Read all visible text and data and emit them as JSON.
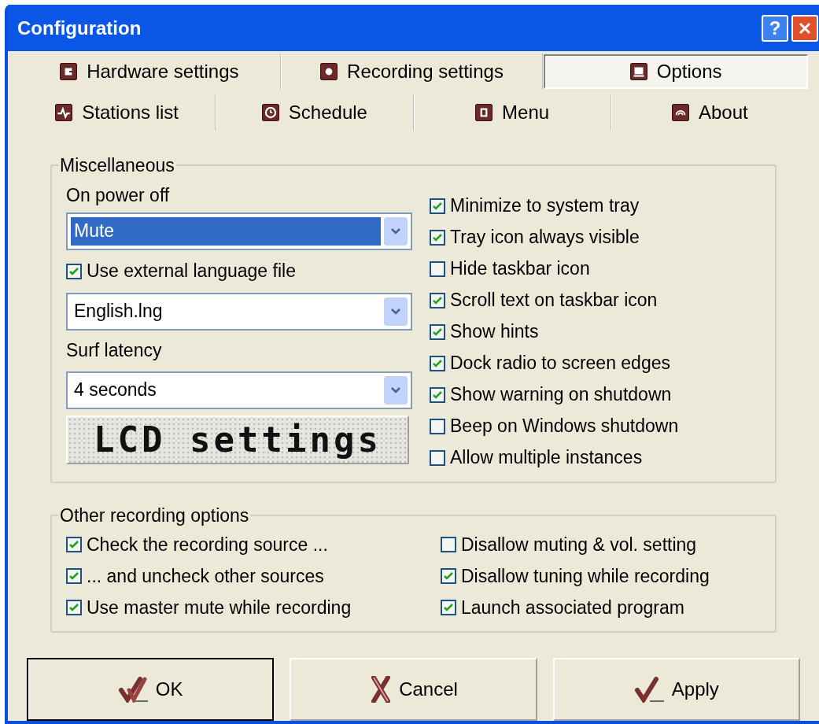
{
  "window": {
    "title": "Configuration",
    "help_button": "?"
  },
  "tabs": [
    [
      {
        "label": "Hardware settings",
        "selected": false
      },
      {
        "label": "Recording settings",
        "selected": false
      },
      {
        "label": "Options",
        "selected": true
      }
    ],
    [
      {
        "label": "Stations list",
        "selected": false
      },
      {
        "label": "Schedule",
        "selected": false
      },
      {
        "label": "Menu",
        "selected": false
      },
      {
        "label": "About",
        "selected": false
      }
    ]
  ],
  "miscellaneous": {
    "title": "Miscellaneous",
    "power_off": {
      "label": "On power off",
      "value": "Mute",
      "focused": true
    },
    "language": {
      "label": "Use external language file",
      "checked": true,
      "value": "English.lng",
      "focused": false
    },
    "surf_latency": {
      "label": "Surf latency",
      "value": "4 seconds",
      "focused": false
    },
    "lcd_button": "LCD settings",
    "options": [
      {
        "label": "Minimize to system tray",
        "checked": true
      },
      {
        "label": "Tray icon always visible",
        "checked": true
      },
      {
        "label": "Hide taskbar icon",
        "checked": false
      },
      {
        "label": "Scroll text on taskbar icon",
        "checked": true
      },
      {
        "label": "Show hints",
        "checked": true
      },
      {
        "label": "Dock radio to screen edges",
        "checked": true
      },
      {
        "label": "Show warning on shutdown",
        "checked": true
      },
      {
        "label": "Beep on Windows shutdown",
        "checked": false
      },
      {
        "label": "Allow multiple instances",
        "checked": false
      }
    ]
  },
  "recording_options": {
    "title": "Other recording options",
    "left": [
      {
        "label": "Check the recording source ...",
        "checked": true
      },
      {
        "label": "... and uncheck other sources",
        "checked": true
      },
      {
        "label": "Use master mute while recording",
        "checked": true
      }
    ],
    "right": [
      {
        "label": "Disallow muting & vol. setting",
        "checked": false
      },
      {
        "label": "Disallow tuning while recording",
        "checked": true
      },
      {
        "label": "Launch associated program",
        "checked": true
      }
    ]
  },
  "buttons": [
    {
      "label": "OK",
      "default": true
    },
    {
      "label": "Cancel",
      "default": false
    },
    {
      "label": "Apply",
      "default": false
    }
  ]
}
